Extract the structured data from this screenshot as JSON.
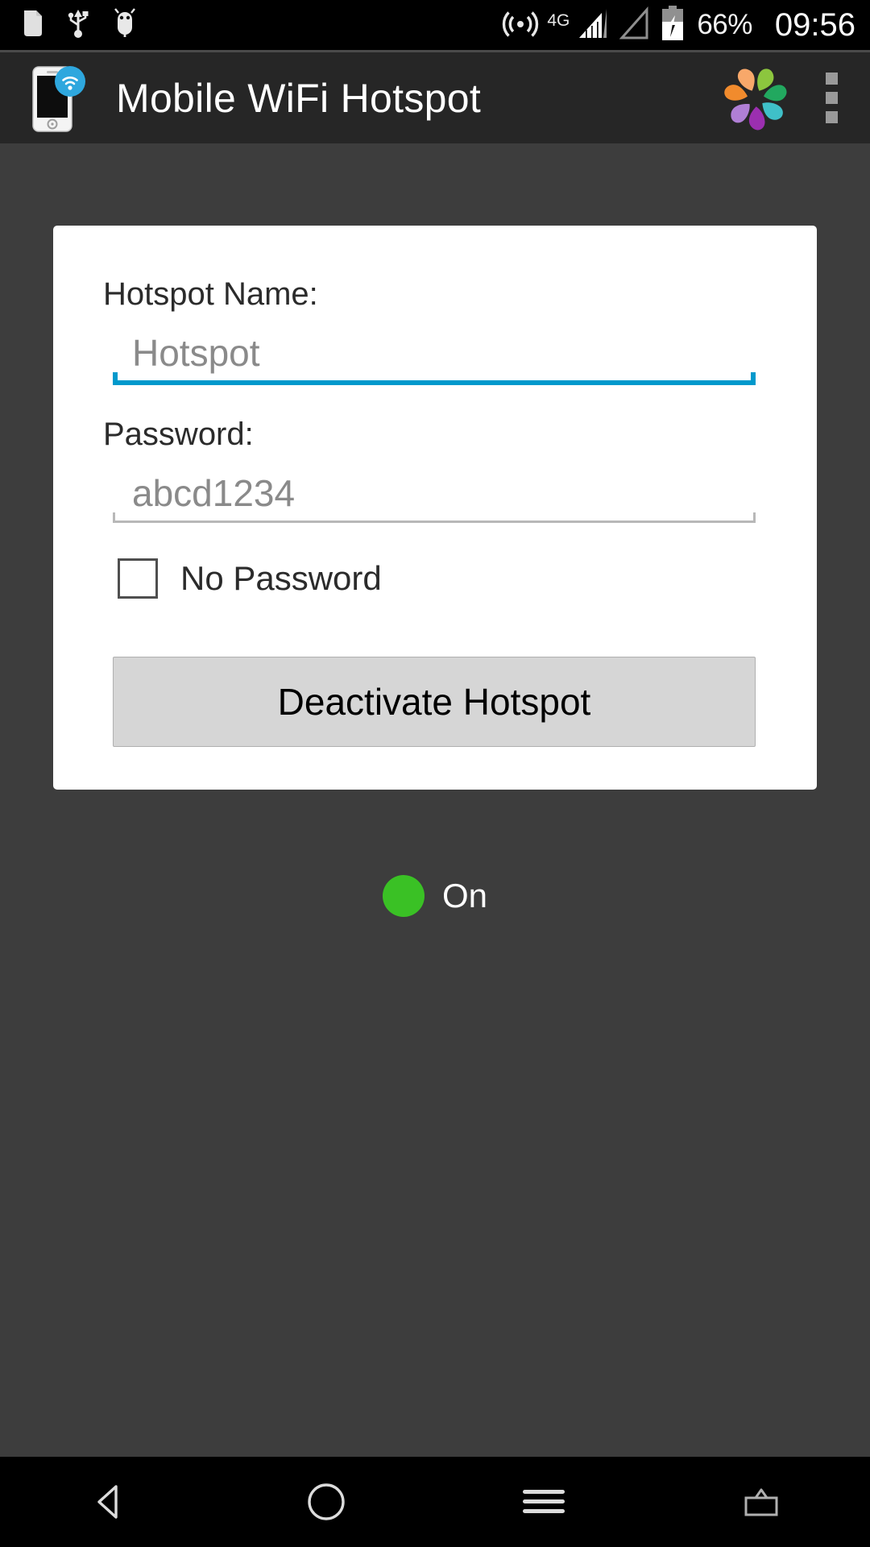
{
  "status_bar": {
    "left_icons": [
      {
        "name": "document-icon",
        "label": "file"
      },
      {
        "name": "usb-icon",
        "label": "USB"
      },
      {
        "name": "android-debug-icon",
        "label": "ADB"
      }
    ],
    "right_icons": [
      {
        "name": "hotspot-icon",
        "label": "hotspot"
      },
      {
        "name": "signal-bars-icon",
        "label": "signal sim1"
      },
      {
        "name": "signal-empty-icon",
        "label": "signal sim2"
      },
      {
        "name": "battery-charging-icon",
        "label": "battery charging"
      }
    ],
    "network_type": "4G",
    "battery_percent": "66%",
    "clock": "09:56"
  },
  "app_bar": {
    "title": "Mobile WiFi Hotspot",
    "app_icon_name": "phone-wifi-icon",
    "brand_logo_name": "pinwheel-logo",
    "overflow_name": "overflow-menu-icon",
    "brand_colors": [
      "#f18b2d",
      "#f8a86a",
      "#8cc63e",
      "#22a85f",
      "#3fc0c8",
      "#9b59b6",
      "#b07fd6"
    ]
  },
  "card": {
    "hotspot_name": {
      "label": "Hotspot Name:",
      "value": "",
      "placeholder": "Hotspot",
      "focused": true,
      "underline_color": "#0099cc"
    },
    "password": {
      "label": "Password:",
      "value": "",
      "placeholder": "abcd1234",
      "focused": false,
      "underline_color": "#b8b8b8"
    },
    "no_password_checkbox": {
      "label": "No Password",
      "checked": false
    },
    "action_button": {
      "label": "Deactivate Hotspot"
    }
  },
  "status_indicator": {
    "label": "On",
    "color": "#3ac125"
  },
  "nav_bar": {
    "buttons": [
      {
        "name": "nav-back-button",
        "label": "Back"
      },
      {
        "name": "nav-home-button",
        "label": "Home"
      },
      {
        "name": "nav-menu-button",
        "label": "Menu"
      },
      {
        "name": "nav-recents-button",
        "label": "Recents"
      }
    ]
  },
  "theme": {
    "status_bar_bg": "#000000",
    "app_bar_bg": "#262626",
    "page_bg": "#3d3d3d",
    "card_bg": "#ffffff",
    "accent": "#0099cc"
  }
}
